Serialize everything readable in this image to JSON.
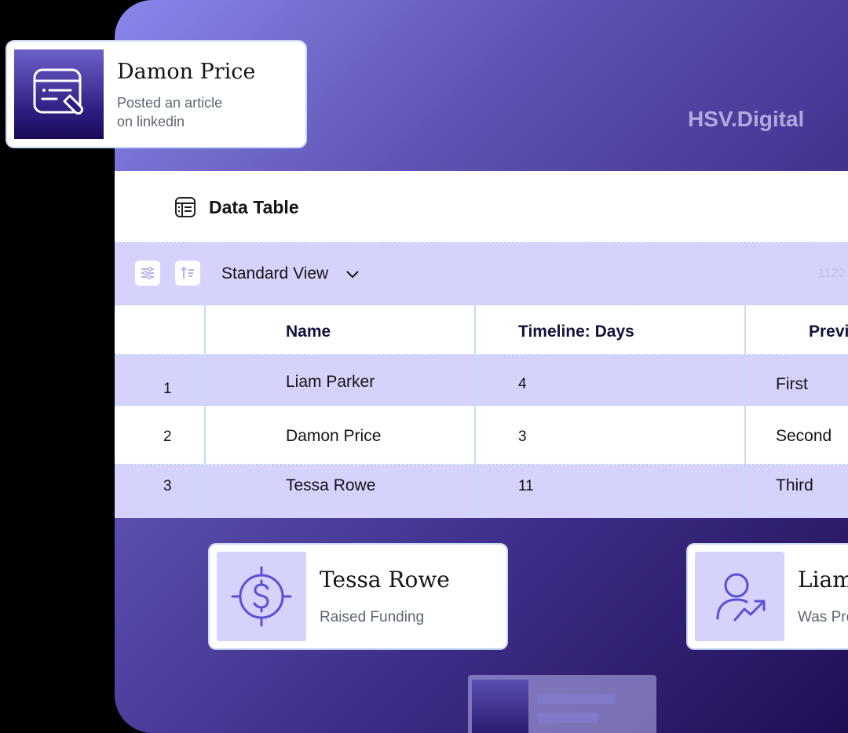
{
  "brand": "HSV.Digital",
  "data_table": {
    "title": "Data Table",
    "icon": "table-icon"
  },
  "toolbar": {
    "filter_icon": "sliders-icon",
    "sort_icon": "sort-icon",
    "view_label": "Standard View",
    "view_icon": "chevron-down-icon",
    "count_partial": "1122"
  },
  "table": {
    "columns": [
      "",
      "Name",
      "Timeline: Days",
      "Previ"
    ],
    "rows": [
      {
        "num": "1",
        "name": "Liam Parker",
        "days": "4",
        "prev": "First"
      },
      {
        "num": "2",
        "name": "Damon Price",
        "days": "3",
        "prev": "Second"
      },
      {
        "num": "3",
        "name": "Tessa Rowe",
        "days": "11",
        "prev": "Third"
      }
    ]
  },
  "notification": {
    "name": "Damon Price",
    "line1": "Posted an article",
    "line2": "on linkedin",
    "icon": "article-edit-icon"
  },
  "cards": [
    {
      "name": "Tessa Rowe",
      "sub": "Raised Funding",
      "icon": "dollar-target-icon"
    },
    {
      "name": "Liam",
      "sub": "Was Pro",
      "icon": "user-growth-icon"
    }
  ],
  "colors": {
    "accent": "#5b4fd6",
    "row_highlight": "#d5d2fc",
    "panel_dark": "#1d0b4f"
  }
}
